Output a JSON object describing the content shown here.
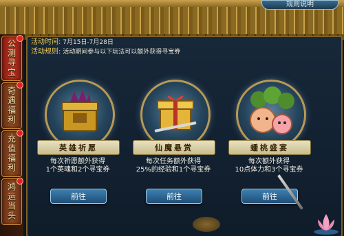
{
  "header": {
    "corner_label": "规则说明"
  },
  "sidebar": {
    "tabs": [
      {
        "label": "公测寻宝"
      },
      {
        "label": "奇遇福利"
      },
      {
        "label": "充值福利"
      },
      {
        "label": "鸿运当头"
      }
    ]
  },
  "info": {
    "time_key": "活动时间:",
    "time_value": "7月15日-7月28日",
    "rule_key": "活动规则:",
    "rule_value": "活动期间参与以下玩法可以额外获得寻宝券"
  },
  "cards": [
    {
      "title": "英雄祈愿",
      "line1": "每次祈愿额外获得",
      "line2": "1个英魂和2个寻宝券",
      "button": "前往"
    },
    {
      "title": "仙魔悬赏",
      "line1": "每次任务额外获得",
      "line2": "25%的经验和1个寻宝券",
      "button": "前往"
    },
    {
      "title": "蟠桃盛宴",
      "line1": "每次额外获得",
      "line2": "10点体力和3个寻宝券",
      "button": "前往"
    }
  ],
  "colors": {
    "accent_gold": "#f2c94c",
    "button_blue": "#2f6f9f",
    "tab_red": "#b6321e"
  },
  "icons": {
    "card1": "treasure-chest-icon",
    "card2": "golden-gift-box-icon",
    "card3": "peach-spirits-icon",
    "lotus": "lotus-flower-icon"
  }
}
